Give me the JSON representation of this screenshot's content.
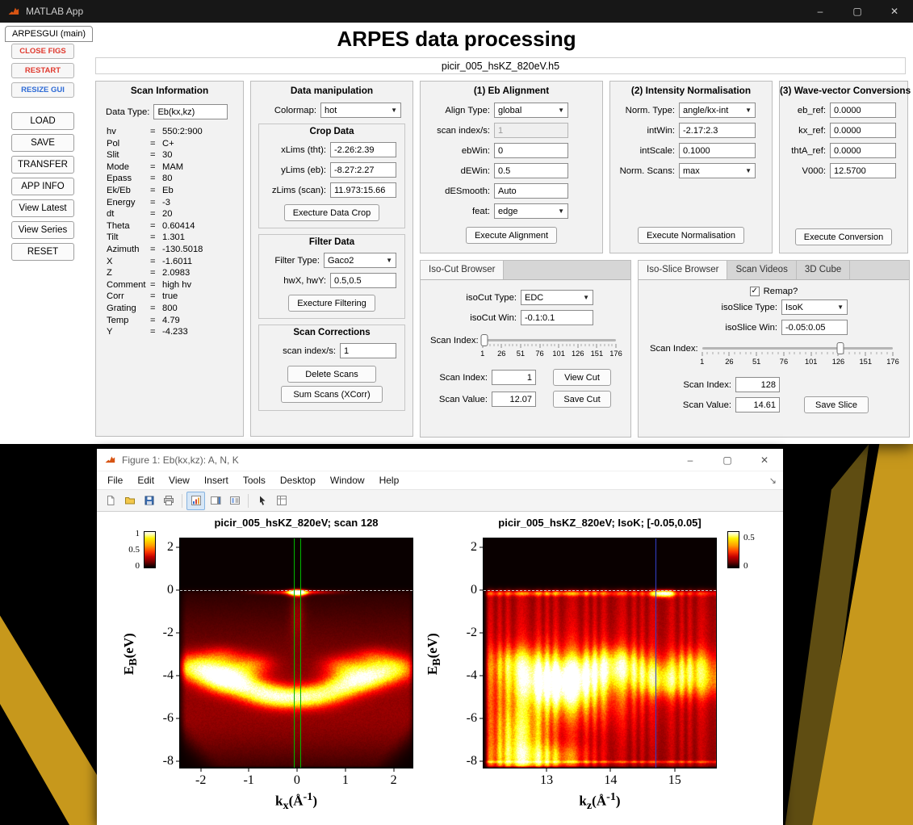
{
  "app": {
    "titlebar": {
      "title": "MATLAB App",
      "min": "–",
      "max": "▢",
      "close": "✕"
    },
    "tab": "ARPESGUI (main)",
    "heading": "ARPES data processing",
    "filename": "picir_005_hsKZ_820eV.h5",
    "eq": "=",
    "dd_arrow": "▼",
    "sidebar": {
      "close_figs": "CLOSE FIGS",
      "restart": "RESTART",
      "resize": "RESIZE GUI",
      "load": "LOAD",
      "save": "SAVE",
      "transfer": "TRANSFER",
      "app_info": "APP INFO",
      "view_latest": "View Latest",
      "view_series": "View Series",
      "reset": "RESET"
    },
    "scan_info": {
      "title": "Scan Information",
      "data_type_label": "Data Type:",
      "data_type_value": "Eb(kx,kz)",
      "lines": [
        {
          "k": "hv",
          "v": "550:2:900"
        },
        {
          "k": "Pol",
          "v": "C+"
        },
        {
          "k": "Slit",
          "v": "30"
        },
        {
          "k": "Mode",
          "v": "MAM"
        },
        {
          "k": "Epass",
          "v": "80"
        },
        {
          "k": "Ek/Eb",
          "v": "Eb"
        },
        {
          "k": "Energy",
          "v": "-3"
        },
        {
          "k": "dt",
          "v": "20"
        },
        {
          "k": "Theta",
          "v": "0.60414"
        },
        {
          "k": "Tilt",
          "v": "1.301"
        },
        {
          "k": "Azimuth",
          "v": "-130.5018"
        },
        {
          "k": "X",
          "v": "-1.6011"
        },
        {
          "k": "Z",
          "v": "2.0983"
        },
        {
          "k": "Comment",
          "v": "high hv"
        },
        {
          "k": "Corr",
          "v": "true"
        },
        {
          "k": "Grating",
          "v": "800"
        },
        {
          "k": "Temp",
          "v": "4.79"
        },
        {
          "k": "Y",
          "v": "-4.233"
        }
      ]
    },
    "manip": {
      "title": "Data manipulation",
      "colormap_label": "Colormap:",
      "colormap_value": "hot",
      "crop": {
        "title": "Crop Data",
        "rows": [
          {
            "label": "xLims (tht):",
            "value": "-2.26:2.39"
          },
          {
            "label": "yLims (eb):",
            "value": "-8.27:2.27"
          },
          {
            "label": "zLims (scan):",
            "value": "11.973:15.66"
          }
        ],
        "button": "Execture Data Crop"
      },
      "filter": {
        "title": "Filter Data",
        "type_label": "Filter Type:",
        "type_value": "Gaco2",
        "hw_label": "hwX, hwY:",
        "hw_value": "0.5,0.5",
        "button": "Execture Filtering"
      },
      "corr": {
        "title": "Scan Corrections",
        "index_label": "scan index/s:",
        "index_value": "1",
        "delete_button": "Delete Scans",
        "sum_button": "Sum Scans (XCorr)"
      }
    },
    "align": {
      "title": "(1) Eb Alignment",
      "align_type_label": "Align Type:",
      "align_type": "global",
      "scan_index_label": "scan index/s:",
      "scan_index": "1",
      "ebwin_label": "ebWin:",
      "ebwin": "0",
      "dewin_label": "dEWin:",
      "dewin": "0.5",
      "desmooth_label": "dESmooth:",
      "desmooth": "Auto",
      "feat_label": "feat:",
      "feat": "edge",
      "button": "Execute Alignment"
    },
    "norm": {
      "title": "(2) Intensity Normalisation",
      "type_label": "Norm. Type:",
      "type_value": "angle/kx-int",
      "intwin_label": "intWin:",
      "intwin": "-2.17:2.3",
      "intscale_label": "intScale:",
      "intscale": "0.1000",
      "scans_label": "Norm. Scans:",
      "scans_value": "max",
      "button": "Execute Normalisation"
    },
    "conv": {
      "title": "(3) Wave-vector Conversions",
      "ebref_label": "eb_ref:",
      "ebref": "0.0000",
      "kxref_label": "kx_ref:",
      "kxref": "0.0000",
      "thta_label": "thtA_ref:",
      "thta": "0.0000",
      "v000_label": "V000:",
      "v000": "12.5700",
      "button": "Execute Conversion"
    },
    "isocut": {
      "tab": "Iso-Cut Browser",
      "type_label": "isoCut Type:",
      "type_value": "EDC",
      "win_label": "isoCut Win:",
      "win_value": "-0.1:0.1",
      "slider_label": "Scan Index:",
      "slider": {
        "ticks": [
          "1",
          "26",
          "51",
          "76",
          "101",
          "126",
          "151",
          "176"
        ],
        "thumb": 0.015
      },
      "index_label": "Scan Index:",
      "index_value": "1",
      "value_label": "Scan Value:",
      "value_value": "12.07",
      "view_button": "View Cut",
      "save_button": "Save Cut"
    },
    "isoslice": {
      "tabs": [
        "Iso-Slice Browser",
        "Scan Videos",
        "3D Cube"
      ],
      "check_glyph": "✓",
      "remap_label": "Remap?",
      "type_label": "isoSlice Type:",
      "type_value": "IsoK",
      "win_label": "isoSlice Win:",
      "win_value": "-0.05:0.05",
      "slider_label": "Scan Index:",
      "slider": {
        "ticks": [
          "1",
          "26",
          "51",
          "76",
          "101",
          "126",
          "151",
          "176"
        ],
        "thumb": 0.726
      },
      "index_label": "Scan Index:",
      "index_value": "128",
      "value_label": "Scan Value:",
      "value_value": "14.61",
      "save_button": "Save Slice"
    }
  },
  "figure": {
    "titlebar": {
      "title": "Figure 1: Eb(kx,kz): A, N, K",
      "min": "–",
      "max": "▢",
      "close": "✕"
    },
    "dock_icon": "↘",
    "menus": [
      "File",
      "Edit",
      "View",
      "Insert",
      "Tools",
      "Desktop",
      "Window",
      "Help"
    ],
    "plots": [
      {
        "title": "picir_005_hsKZ_820eV; scan 128",
        "xlabel": {
          "base": "k",
          "sub": "x",
          "open": "(Å",
          "exp": "-1",
          "close": ")"
        },
        "ylabel": {
          "base": "E",
          "sub": "B",
          "rest": "(eV)"
        },
        "xticks": [
          {
            "t": "-2",
            "f": 0.092
          },
          {
            "t": "-1",
            "f": 0.297
          },
          {
            "t": "0",
            "f": 0.503
          },
          {
            "t": "1",
            "f": 0.71
          },
          {
            "t": "2",
            "f": 0.916
          }
        ],
        "yticks": [
          {
            "t": "2",
            "f": 0.042
          },
          {
            "t": "0",
            "f": 0.227
          },
          {
            "t": "-2",
            "f": 0.413
          },
          {
            "t": "-4",
            "f": 0.598
          },
          {
            "t": "-6",
            "f": 0.783
          },
          {
            "t": "-8",
            "f": 0.969
          }
        ],
        "cbar_ticks": [
          {
            "t": "1",
            "f": 0.06
          },
          {
            "t": "0.5",
            "f": 0.5
          },
          {
            "t": "0",
            "f": 0.94
          }
        ]
      },
      {
        "title": "picir_005_hsKZ_820eV; IsoK; [-0.05,0.05]",
        "xlabel": {
          "base": "k",
          "sub": "z",
          "open": "(Å",
          "exp": "-1",
          "close": ")"
        },
        "ylabel": {
          "base": "E",
          "sub": "B",
          "rest": "(eV)"
        },
        "xticks": [
          {
            "t": "13",
            "f": 0.273
          },
          {
            "t": "14",
            "f": 0.546
          },
          {
            "t": "15",
            "f": 0.82
          }
        ],
        "yticks": [
          {
            "t": "2",
            "f": 0.042
          },
          {
            "t": "0",
            "f": 0.227
          },
          {
            "t": "-2",
            "f": 0.413
          },
          {
            "t": "-4",
            "f": 0.598
          },
          {
            "t": "-6",
            "f": 0.783
          },
          {
            "t": "-8",
            "f": 0.969
          }
        ],
        "cbar_ticks": [
          {
            "t": "0.5",
            "f": 0.18
          },
          {
            "t": "0",
            "f": 0.94
          }
        ]
      }
    ]
  },
  "chart_data": [
    {
      "type": "heatmap",
      "title": "picir_005_hsKZ_820eV; scan 128",
      "xlabel": "k_x (Å^-1)",
      "ylabel": "E_B (eV)",
      "xlim": [
        -2.45,
        2.42
      ],
      "ylim": [
        -8.34,
        2.45
      ],
      "xticks": [
        -2,
        -1,
        0,
        1,
        2
      ],
      "yticks": [
        2,
        0,
        -2,
        -4,
        -6,
        -8
      ],
      "colormap": "hot",
      "colorbar_range": [
        0,
        1
      ],
      "colorbar_ticks": [
        0,
        0.5,
        1
      ],
      "annotations": {
        "dashed_fermi_line_eb": 0,
        "green_cut_window_kx": [
          -0.1,
          0.1
        ]
      },
      "notable_features": [
        "bright spot at (kx=0, EB=0)",
        "W-shaped dispersive bands between EB=-3.5 and -5",
        "diffuse intensity to EB=-8 with dark bottom corners"
      ]
    },
    {
      "type": "heatmap",
      "title": "picir_005_hsKZ_820eV; IsoK; [-0.05,0.05]",
      "xlabel": "k_z (Å^-1)",
      "ylabel": "E_B (eV)",
      "xlim": [
        12.0,
        15.66
      ],
      "ylim": [
        -8.34,
        2.45
      ],
      "xticks": [
        13,
        14,
        15
      ],
      "yticks": [
        2,
        0,
        -2,
        -4,
        -6,
        -8
      ],
      "colormap": "hot",
      "colorbar_range": [
        0,
        0.55
      ],
      "colorbar_ticks": [
        0,
        0.5
      ],
      "annotations": {
        "dashed_fermi_line_eb": 0,
        "blue_scan_marker_kz": 14.61
      },
      "notable_features": [
        "Fermi-level stripe at EB=0 with intense spot near kz=14.8",
        "broad bands EB=-3 to -5",
        "bright region near kz=12.6, EB=-7"
      ]
    }
  ]
}
